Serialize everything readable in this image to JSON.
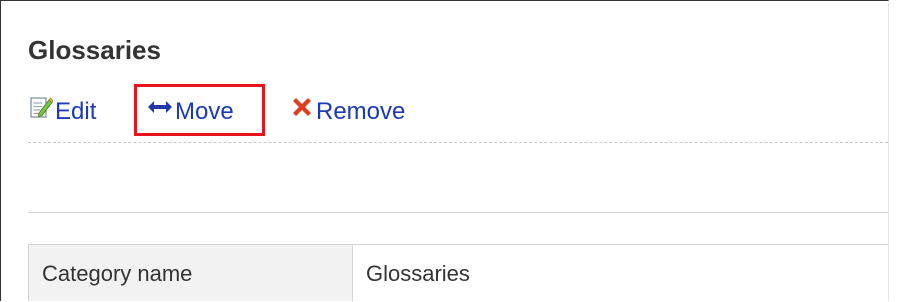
{
  "page": {
    "title": "Glossaries"
  },
  "toolbar": {
    "edit": {
      "label": "Edit",
      "icon": "edit-icon"
    },
    "move": {
      "label": "Move",
      "icon": "move-arrows-icon"
    },
    "remove": {
      "label": "Remove",
      "icon": "remove-x-icon"
    }
  },
  "details": {
    "rows": [
      {
        "label": "Category name",
        "value": "Glossaries"
      }
    ]
  },
  "colors": {
    "link": "#1a3ab8",
    "highlight": "#e8141c",
    "remove_icon": "#e03c1e",
    "label_bg": "#f2f2f2"
  }
}
